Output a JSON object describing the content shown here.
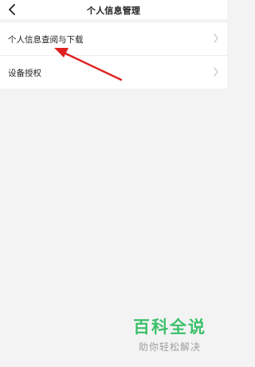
{
  "header": {
    "title": "个人信息管理",
    "back_icon": "chevron-left-icon"
  },
  "menu": {
    "items": [
      {
        "label": "个人信息查阅与下载",
        "icon": "chevron-right-icon"
      },
      {
        "label": "设备授权",
        "icon": "chevron-right-icon"
      }
    ]
  },
  "annotation": {
    "arrow_color": "#e02020"
  },
  "watermark": {
    "title": "百科全说",
    "subtitle": "助你轻松解决",
    "color": "#3cbf6a"
  }
}
